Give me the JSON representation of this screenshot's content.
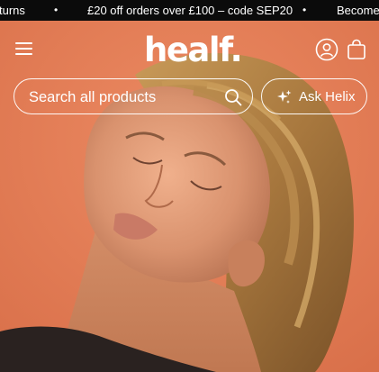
{
  "announcement": {
    "left_fragment": "turns",
    "promo": "£20 off orders over £100 – code SEP20",
    "right_fragment": "Become",
    "separator": "•"
  },
  "header": {
    "logo": "healf.",
    "menu_icon": "hamburger-menu-icon",
    "account_icon": "user-account-icon",
    "bag_icon": "shopping-bag-icon"
  },
  "search": {
    "placeholder": "Search all products",
    "icon": "search-icon"
  },
  "ask_button": {
    "label": "Ask Helix",
    "icon": "sparkle-icon"
  },
  "hero": {
    "image": "woman-eyes-closed-portrait"
  },
  "colors": {
    "background": "#e27b55",
    "announcement_bar": "#0b0b0b",
    "text": "#ffffff"
  }
}
